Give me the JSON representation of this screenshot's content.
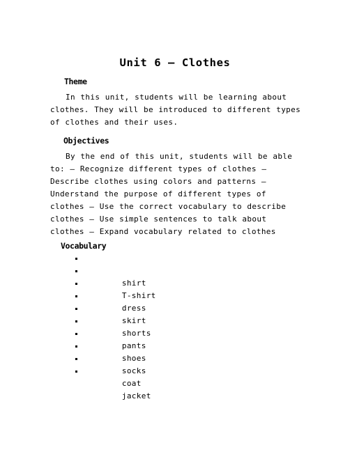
{
  "document": {
    "title": "Unit 6 – Clothes",
    "sections": [
      {
        "heading": "Theme",
        "body": "In this unit, students will be learning about clothes. They will be introduced to different types of clothes and their uses."
      },
      {
        "heading": "Objectives",
        "body": "By the end of this unit, students will be able to: – Recognize different types of clothes – Describe clothes using colors and patterns – Understand the purpose of different types of clothes – Use the correct vocabulary to describe clothes – Use simple sentences to talk about clothes – Expand vocabulary related to clothes"
      },
      {
        "heading": "Vocabulary"
      }
    ],
    "vocabulary": [
      "shirt",
      "T-shirt",
      "dress",
      "skirt",
      "shorts",
      "pants",
      "shoes",
      "socks",
      "coat",
      "jacket"
    ]
  }
}
